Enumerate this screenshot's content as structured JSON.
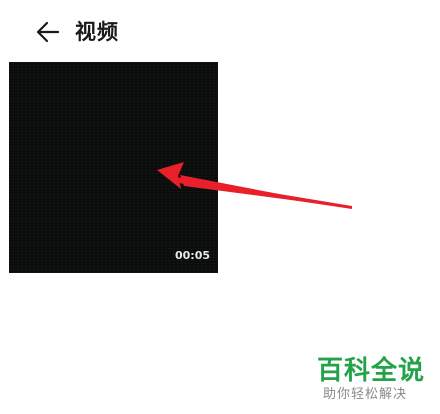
{
  "header": {
    "back_icon": "arrow-left-icon",
    "title": "视频"
  },
  "video": {
    "duration": "00:05"
  },
  "annotation": {
    "icon": "red-arrow",
    "color": "#e8202a"
  },
  "watermark": {
    "title": "百科全说",
    "subtitle": "助你轻松解决",
    "color": "#23a24a"
  }
}
